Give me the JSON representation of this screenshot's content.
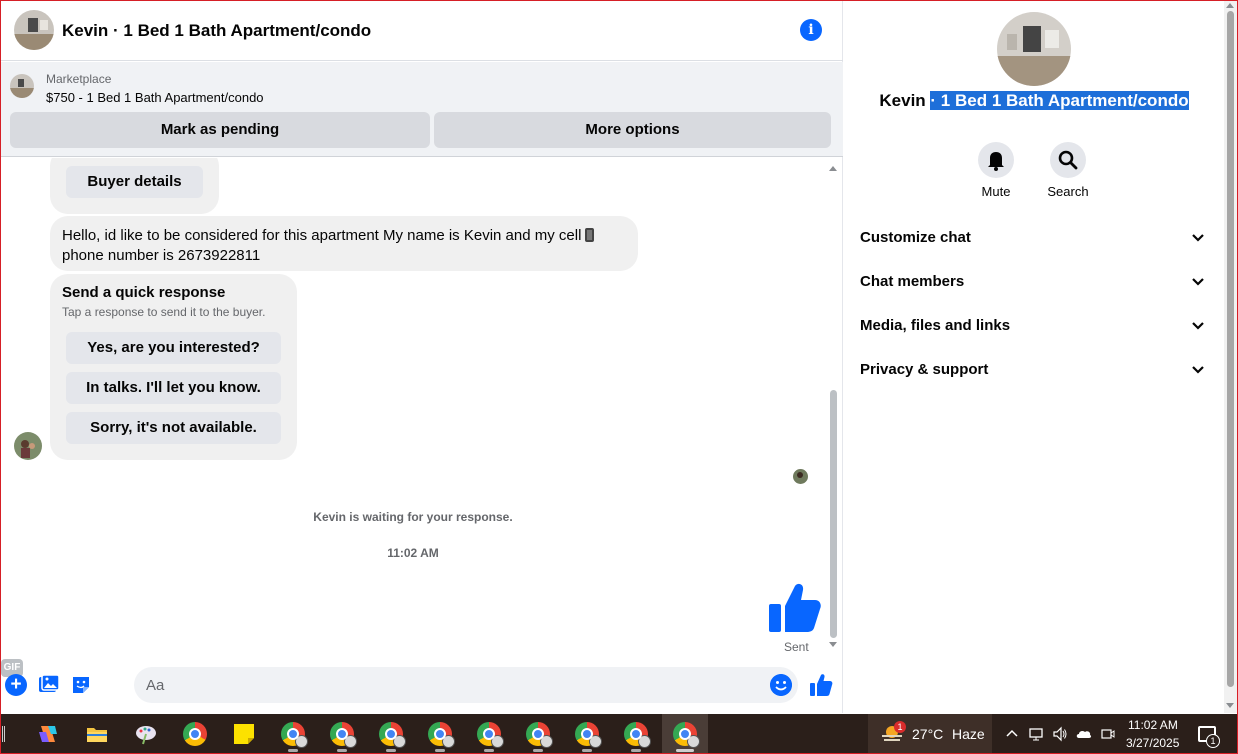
{
  "header": {
    "title": "Kevin · 1 Bed 1 Bath Apartment/condo"
  },
  "marketplace": {
    "label": "Marketplace",
    "listing": "$750 - 1 Bed 1 Bath Apartment/condo",
    "mark_pending_label": "Mark as pending",
    "more_options_label": "More options"
  },
  "messages": {
    "buyer_details_label": "Buyer details",
    "incoming_message": "Hello, id like to be considered for this apartment My name is Kevin and my cell",
    "incoming_message_cont": "phone number is 2673922811",
    "quick_response": {
      "title": "Send a quick response",
      "subtitle": "Tap a response to send it to the buyer.",
      "options": [
        "Yes, are you interested?",
        "In talks. I'll let you know.",
        "Sorry, it's not available."
      ]
    },
    "waiting_text": "Kevin is waiting for your response.",
    "timestamp": "11:02 AM",
    "sent_label": "Sent"
  },
  "composer": {
    "placeholder": "Aa",
    "gif_label": "GIF"
  },
  "info_pane": {
    "name_prefix": "Kevin ",
    "name_selected": "· 1 Bed 1 Bath Apartment/condo",
    "mute_label": "Mute",
    "search_label": "Search",
    "sections": [
      "Customize chat",
      "Chat members",
      "Media, files and links",
      "Privacy & support"
    ]
  },
  "taskbar": {
    "weather_badge": "1",
    "temperature": "27°C",
    "condition": "Haze",
    "clock_time": "11:02 AM",
    "clock_date": "3/27/2025",
    "notification_count": "1"
  },
  "colors": {
    "messenger_blue": "#0866ff",
    "selection_blue": "#1e6fd9",
    "bubble_gray": "#f0f0f0",
    "taskbar_bg": "#2b1f1a"
  }
}
